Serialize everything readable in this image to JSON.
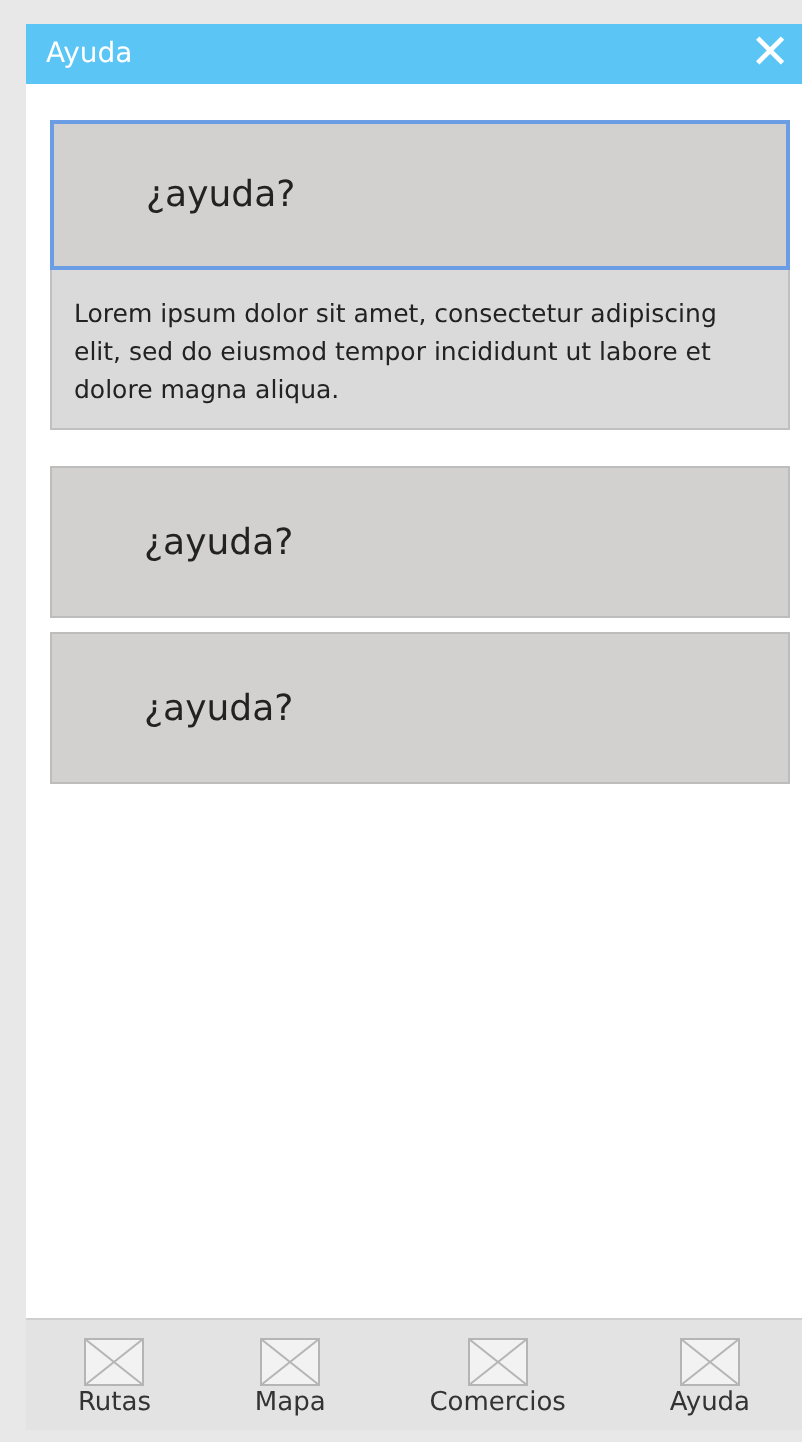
{
  "window": {
    "title": "Ayuda",
    "close": "✕"
  },
  "faq": [
    {
      "question": "¿ayuda?",
      "expanded": true,
      "answer": "Lorem ipsum dolor sit amet, consectetur adipiscing elit, sed do eiusmod tempor incididunt ut labore et dolore magna aliqua."
    },
    {
      "question": "¿ayuda?",
      "expanded": false
    },
    {
      "question": "¿ayuda?",
      "expanded": false
    }
  ],
  "nav": [
    {
      "label": "Rutas"
    },
    {
      "label": "Mapa"
    },
    {
      "label": "Comercios"
    },
    {
      "label": "Ayuda"
    }
  ]
}
